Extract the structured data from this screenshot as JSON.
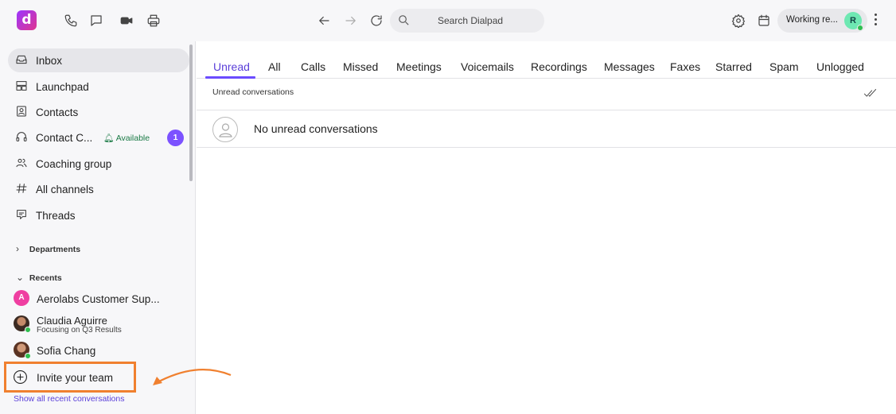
{
  "app": {
    "logo_letter": "d",
    "brand_color": "#9b35ff"
  },
  "topbar": {
    "search_placeholder": "Search Dialpad",
    "status_label": "Working re...",
    "avatar_initial": "R"
  },
  "sidebar": {
    "nav": [
      {
        "label": "Inbox",
        "icon": "inbox-icon"
      },
      {
        "label": "Launchpad",
        "icon": "launchpad-icon"
      },
      {
        "label": "Contacts",
        "icon": "contacts-icon"
      },
      {
        "label": "Contact C...",
        "icon": "headset-icon",
        "status": "Available",
        "badge": "1"
      },
      {
        "label": "Coaching group",
        "icon": "group-icon"
      },
      {
        "label": "All channels",
        "icon": "hash-icon"
      },
      {
        "label": "Threads",
        "icon": "threads-icon"
      }
    ],
    "departments_label": "Departments",
    "recents_label": "Recents",
    "recents": [
      {
        "name": "Aerolabs Customer Sup...",
        "initial": "A"
      },
      {
        "name": "Claudia Aguirre",
        "status_text": "Focusing on Q3 Results"
      },
      {
        "name": "Sofia Chang"
      }
    ],
    "invite_label": "Invite your team",
    "show_all_label": "Show all recent conversations"
  },
  "tabs": [
    "Unread",
    "All",
    "Calls",
    "Missed",
    "Meetings",
    "Voicemails",
    "Recordings",
    "Messages",
    "Faxes",
    "Starred",
    "Spam",
    "Unlogged"
  ],
  "active_tab": "Unread",
  "inbox": {
    "subheader": "Unread conversations",
    "empty_text": "No unread conversations"
  },
  "colors": {
    "accent": "#6b4bff",
    "highlight": "#f0802f",
    "online": "#2fbf4f"
  }
}
